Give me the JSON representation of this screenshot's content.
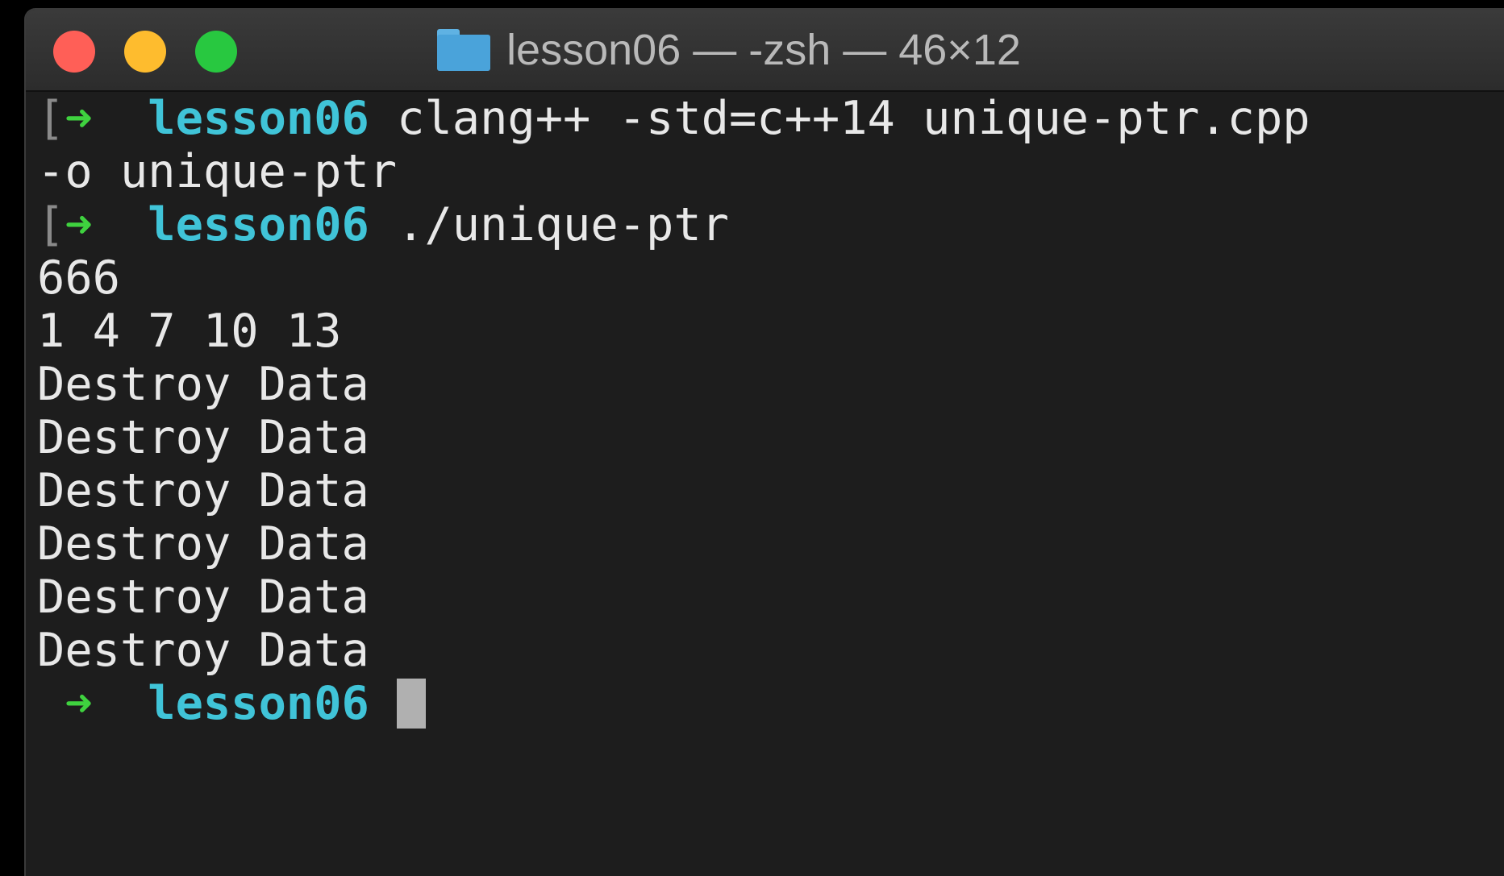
{
  "window": {
    "title": "lesson06 — -zsh — 46×12",
    "colors": {
      "close": "#ff5f57",
      "minimize": "#febc2e",
      "zoom": "#28c840",
      "prompt_arrow": "#3fd23f",
      "prompt_dir": "#40c4d8",
      "background": "#1d1d1d"
    }
  },
  "terminal": {
    "prompt": {
      "bracket": "[",
      "arrow": "➜",
      "dir": "lesson06"
    },
    "line1_cmd": " clang++ -std=c++14 unique-ptr.cpp",
    "line2": "-o unique-ptr",
    "line3_cmd": " ./unique-ptr",
    "output": [
      "666",
      "1 4 7 10 13",
      "Destroy Data",
      "Destroy Data",
      "Destroy Data",
      "Destroy Data",
      "Destroy Data",
      "Destroy Data"
    ]
  }
}
